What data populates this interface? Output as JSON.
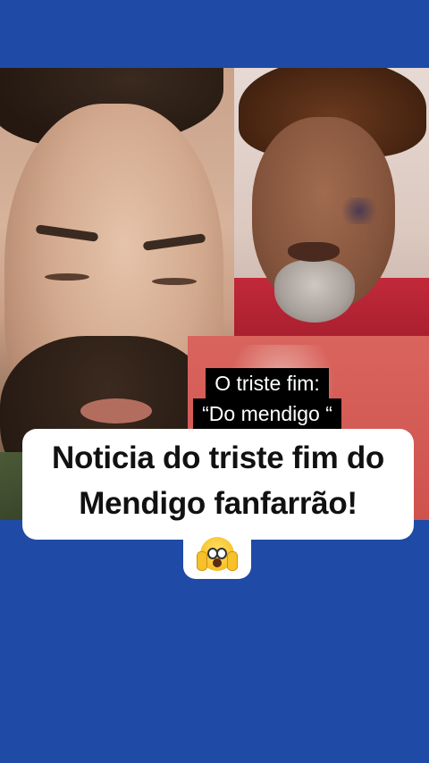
{
  "overlay_caption": {
    "line1": "O triste fim:",
    "line2": "“Do mendigo “"
  },
  "headline": {
    "line1": "Noticia do triste fim do",
    "line2": "Mendigo fanfarrão!"
  },
  "emoji": "screaming-face-emoji",
  "colors": {
    "background": "#1f4ba6",
    "card": "#ffffff",
    "overlay_bg": "#000000"
  }
}
